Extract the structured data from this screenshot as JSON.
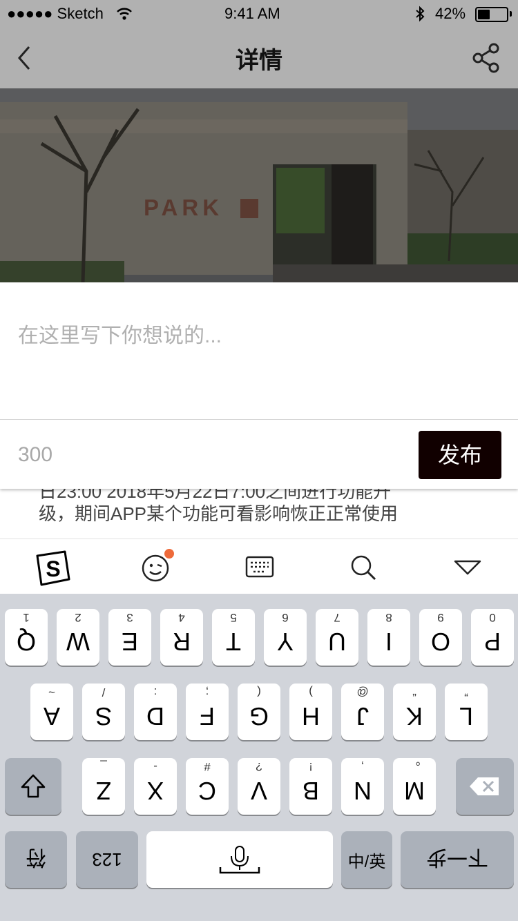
{
  "status_bar": {
    "signal": "●●●●● Sketch",
    "time": "9:41 AM",
    "battery": "42%"
  },
  "nav": {
    "title": "详情",
    "back_icon": "back-chevron",
    "share_icon": "share"
  },
  "hero": {
    "sign_text": "PARK"
  },
  "article": {
    "line1": "日23:00      2018年5月22日7:00之间进行功能升",
    "line2": "级，期间APP某个功能可看影响恢正正常使用"
  },
  "comment": {
    "placeholder": "在这里写下你想说的...",
    "char_count": "300",
    "publish_label": "发布"
  },
  "ime_toolbar": {
    "icons": [
      "sogou-logo",
      "emoji",
      "keyboard",
      "search",
      "collapse"
    ]
  },
  "keyboard": {
    "row1": [
      {
        "main": "Q",
        "sub": "1"
      },
      {
        "main": "W",
        "sub": "2"
      },
      {
        "main": "E",
        "sub": "3"
      },
      {
        "main": "R",
        "sub": "4"
      },
      {
        "main": "T",
        "sub": "5"
      },
      {
        "main": "Y",
        "sub": "6"
      },
      {
        "main": "U",
        "sub": "7"
      },
      {
        "main": "I",
        "sub": "8"
      },
      {
        "main": "O",
        "sub": "9"
      },
      {
        "main": "P",
        "sub": "0"
      }
    ],
    "row2": [
      {
        "main": "A",
        "sub": "~"
      },
      {
        "main": "S",
        "sub": "/"
      },
      {
        "main": "D",
        "sub": ":"
      },
      {
        "main": "F",
        "sub": ";"
      },
      {
        "main": "G",
        "sub": "("
      },
      {
        "main": "H",
        "sub": ")"
      },
      {
        "main": "J",
        "sub": "@"
      },
      {
        "main": "K",
        "sub": "“"
      },
      {
        "main": "L",
        "sub": "”"
      }
    ],
    "row3": [
      {
        "main": "Z",
        "sub": "_"
      },
      {
        "main": "X",
        "sub": "-"
      },
      {
        "main": "C",
        "sub": "#"
      },
      {
        "main": "V",
        "sub": "?"
      },
      {
        "main": "B",
        "sub": "!"
      },
      {
        "main": "N",
        "sub": ","
      },
      {
        "main": "M",
        "sub": "。"
      }
    ],
    "bottom": {
      "symbol": "符",
      "numbers": "123",
      "lang": "中/英",
      "next": "下一步"
    }
  }
}
